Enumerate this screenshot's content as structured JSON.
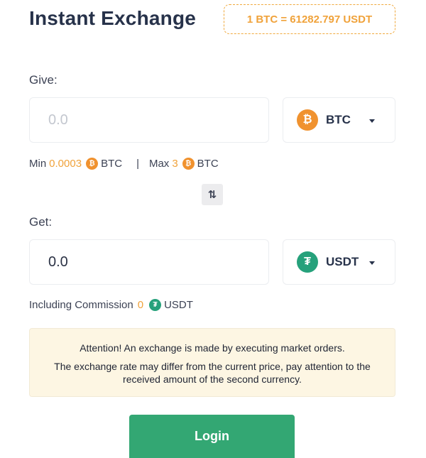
{
  "header": {
    "title": "Instant Exchange",
    "rate": "1 BTC = 61282.797 USDT"
  },
  "give": {
    "label": "Give:",
    "amount_placeholder": "0.0",
    "currency": {
      "code": "BTC",
      "icon": "bitcoin-icon",
      "color": "#f0922f"
    },
    "limits": {
      "min_label": "Min",
      "min_value": "0.0003",
      "min_currency": "BTC",
      "separator": "|",
      "max_label": "Max",
      "max_value": "3",
      "max_currency": "BTC"
    }
  },
  "swap": {
    "icon": "swap-arrows-icon"
  },
  "get": {
    "label": "Get:",
    "amount_value": "0.0",
    "currency": {
      "code": "USDT",
      "icon": "tether-icon",
      "color": "#26a17b"
    },
    "commission": {
      "label": "Including Commission",
      "value": "0",
      "currency": "USDT"
    }
  },
  "notice": {
    "line1": "Attention! An exchange is made by executing market orders.",
    "line2": "The exchange rate may differ from the current price, pay attention to the received amount of the second currency."
  },
  "actions": {
    "login_label": "Login"
  },
  "colors": {
    "accent": "#f0a23a",
    "primary_button": "#33a773",
    "notice_bg": "#fdf6e3"
  }
}
